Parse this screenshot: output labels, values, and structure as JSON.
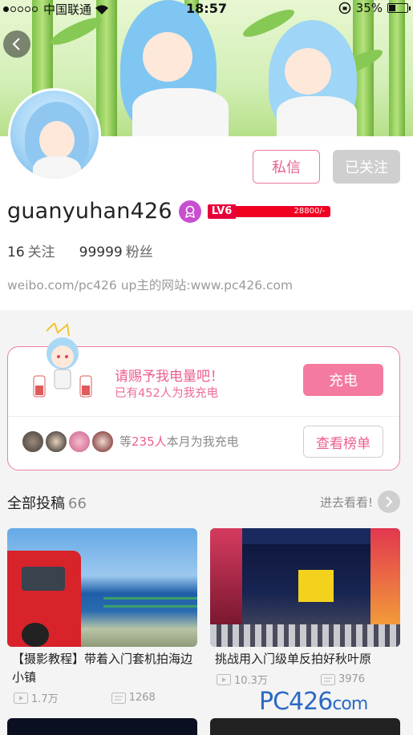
{
  "status_bar": {
    "carrier": "中国联通",
    "time": "18:57",
    "battery": "35%",
    "battery_level": 0.35
  },
  "profile": {
    "message_button": "私信",
    "follow_button": "已关注",
    "username": "guanyuhan426",
    "level_tag": "LV6",
    "level_exp": "28800/-",
    "following_count": "16",
    "following_label": "关注",
    "fans_count": "99999",
    "fans_label": "粉丝",
    "bio": "weibo.com/pc426 up主的网站:www.pc426.com"
  },
  "charge": {
    "ask_text": "请赐予我电量吧！",
    "charged_text": "已有452人为我充电",
    "charge_button": "充电",
    "month_prefix": "等",
    "month_number": "235人",
    "month_suffix": "本月为我充电",
    "rank_button": "查看榜单"
  },
  "posts": {
    "title": "全部投稿",
    "count": "66",
    "see_more": "进去看看!",
    "items": [
      {
        "title": "【摄影教程】带着入门套机拍海边小镇",
        "views": "1.7万",
        "comments": "1268"
      },
      {
        "title": "挑战用入门级单反拍好秋叶原",
        "views": "10.3万",
        "comments": "3976"
      }
    ]
  },
  "watermark": {
    "main": "PC426",
    "tail": "com"
  },
  "colors": {
    "accent": "#ee5e8c",
    "level_red": "#e8003a",
    "brand_blue": "#2a69c4"
  }
}
